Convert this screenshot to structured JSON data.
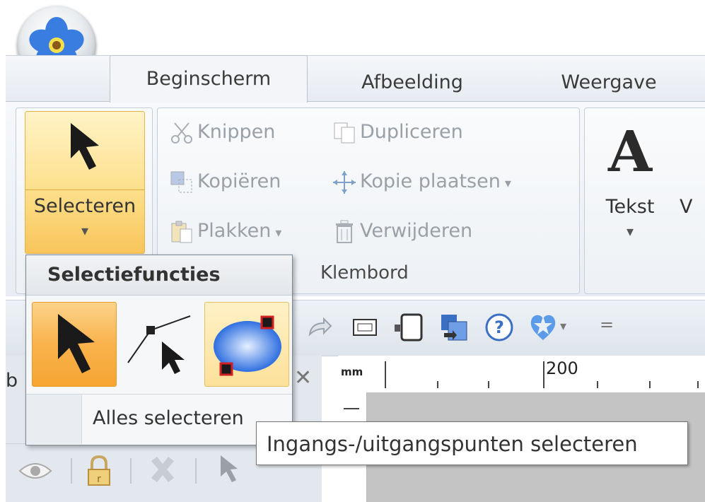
{
  "ribbon": {
    "tabs": [
      {
        "label": "Beginscherm"
      },
      {
        "label": "Afbeelding"
      },
      {
        "label": "Weergave"
      }
    ],
    "select_button": {
      "label": "Selecteren",
      "arrow": "▾"
    },
    "clipboard": {
      "cut_label": "Knippen",
      "copy_label": "Kopiëren",
      "paste_label": "Plakken",
      "duplicate_label": "Dupliceren",
      "paste_copy_label": "Kopie plaatsen",
      "delete_label": "Verwijderen",
      "group_label": "Klembord"
    },
    "text_button": {
      "glyph": "A",
      "label": "Tekst",
      "arrow": "▾",
      "next_partial": "V"
    }
  },
  "popup": {
    "title": "Selectiefuncties",
    "select_all_label": "Alles selecteren",
    "select_all_partial_char": "∇"
  },
  "tooltip": {
    "text": "Ingangs-/uitgangspunten selecteren"
  },
  "panel": {
    "close_glyph": "✕",
    "partial_tab_char": "b"
  },
  "ruler": {
    "unit": "mm",
    "mark": "200"
  },
  "colors": {
    "accent_orange": "#f5a623",
    "selected_fill": "#fbd88a",
    "tooltip_border": "#777777"
  },
  "icons": [
    "orb-flower-icon",
    "arrow-cursor-icon",
    "scissors-icon",
    "copy-icon",
    "paste-icon",
    "duplicate-icon",
    "paste-copy-icon",
    "trash-icon",
    "text-a-icon",
    "select-entry-exit-icon",
    "select-ellipse-icon",
    "eye-icon",
    "lock-icon",
    "redo-icon",
    "help-icon",
    "star-icon"
  ]
}
